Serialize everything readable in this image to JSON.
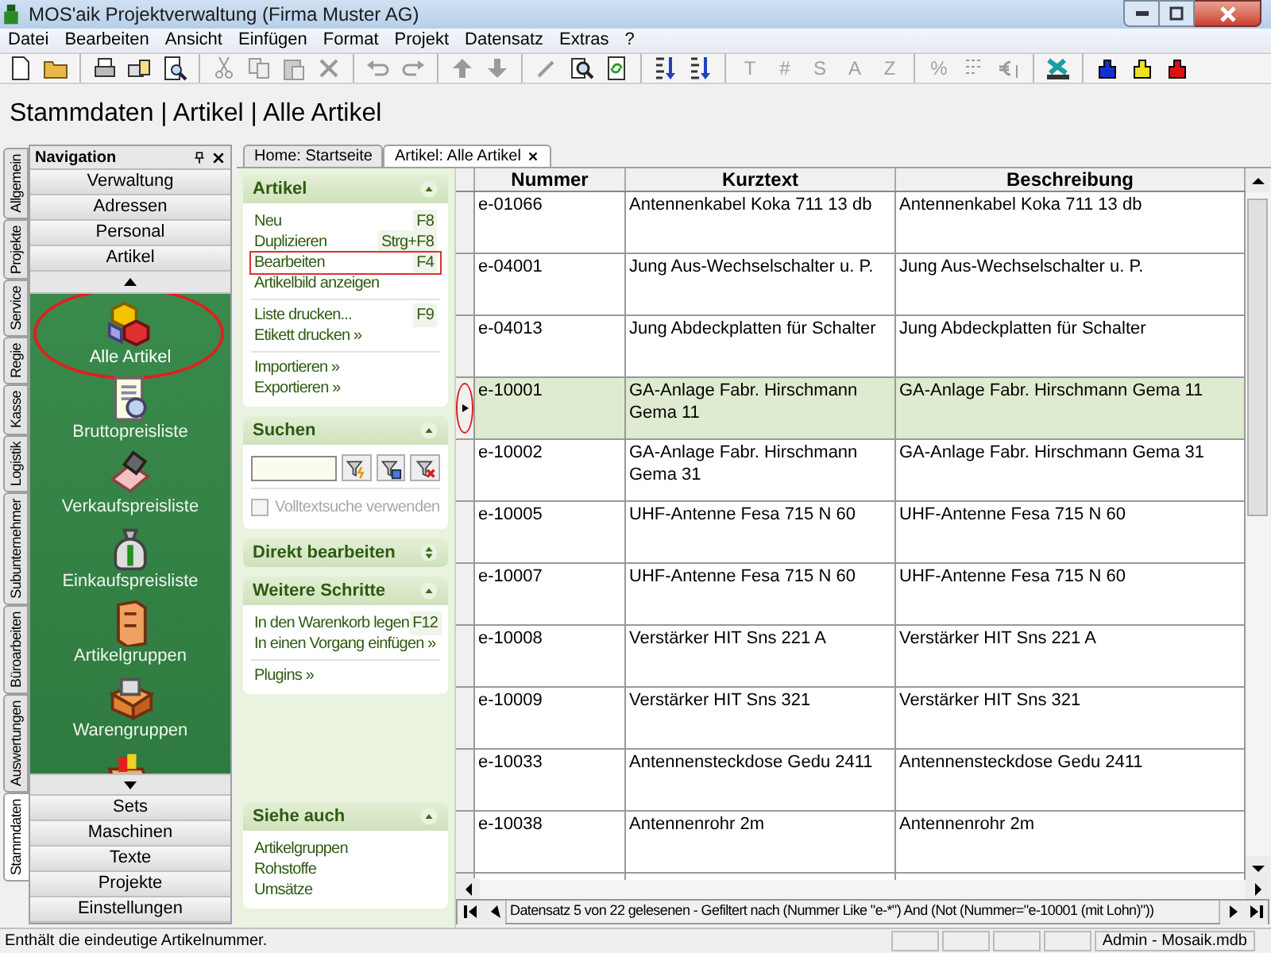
{
  "window": {
    "title": "MOS'aik Projektverwaltung (Firma Muster AG)"
  },
  "menu": [
    "Datei",
    "Bearbeiten",
    "Ansicht",
    "Einfügen",
    "Format",
    "Projekt",
    "Datensatz",
    "Extras",
    "?"
  ],
  "toolbar_glyphs": [
    {
      "text": "T",
      "disabled": true
    },
    {
      "text": "#",
      "disabled": true
    },
    {
      "text": "S",
      "disabled": true
    },
    {
      "text": "A",
      "disabled": true
    },
    {
      "text": "Z",
      "disabled": true
    },
    {
      "text": "%",
      "disabled": true
    }
  ],
  "breadcrumb": "Stammdaten | Artikel | Alle Artikel",
  "side_tabs": [
    {
      "label": "Allgemein",
      "selected": false
    },
    {
      "label": "Projekte",
      "selected": false
    },
    {
      "label": "Service",
      "selected": false
    },
    {
      "label": "Regie",
      "selected": false
    },
    {
      "label": "Kasse",
      "selected": false
    },
    {
      "label": "Logistik",
      "selected": false
    },
    {
      "label": "Subunternehmer",
      "selected": false
    },
    {
      "label": "Büroarbeiten",
      "selected": false
    },
    {
      "label": "Auswertungen",
      "selected": false
    },
    {
      "label": "Stammdaten",
      "selected": true
    }
  ],
  "navigation": {
    "title": "Navigation",
    "top_buttons": [
      "Verwaltung",
      "Adressen",
      "Personal",
      "Artikel"
    ],
    "items": [
      {
        "label": "Alle Artikel",
        "selected": true
      },
      {
        "label": "Bruttopreisliste",
        "selected": false
      },
      {
        "label": "Verkaufspreisliste",
        "selected": false
      },
      {
        "label": "Einkaufspreisliste",
        "selected": false
      },
      {
        "label": "Artikelgruppen",
        "selected": false
      },
      {
        "label": "Warengruppen",
        "selected": false
      }
    ],
    "bottom_buttons": [
      "Sets",
      "Maschinen",
      "Texte",
      "Projekte",
      "Einstellungen"
    ]
  },
  "doc_tabs": [
    {
      "label": "Home: Startseite",
      "selected": false
    },
    {
      "label": "Artikel: Alle Artikel",
      "selected": true
    }
  ],
  "task_panel": {
    "sections": [
      {
        "title": "Artikel",
        "kind": "links",
        "expanded": true,
        "groups": [
          [
            {
              "label": "Neu",
              "shortcut": "F8",
              "highlighted": false
            },
            {
              "label": "Duplizieren",
              "shortcut": "Strg+F8",
              "highlighted": false
            },
            {
              "label": "Bearbeiten",
              "shortcut": "F4",
              "highlighted": true
            },
            {
              "label": "Artikelbild anzeigen",
              "highlighted": false
            }
          ],
          [
            {
              "label": "Liste drucken...",
              "shortcut": "F9",
              "highlighted": false
            },
            {
              "label": "Etikett drucken »",
              "highlighted": false
            }
          ],
          [
            {
              "label": "Importieren »",
              "highlighted": false
            },
            {
              "label": "Exportieren »",
              "highlighted": false
            }
          ]
        ]
      },
      {
        "title": "Suchen",
        "kind": "search",
        "expanded": true,
        "checkbox": {
          "label": "Volltextsuche verwenden",
          "checked": false,
          "disabled": true
        }
      },
      {
        "title": "Direkt bearbeiten",
        "expanded": false
      },
      {
        "title": "Weitere Schritte",
        "kind": "links",
        "expanded": true,
        "groups": [
          [
            {
              "label": "In den Warenkorb legen",
              "shortcut": "F12",
              "highlighted": false
            },
            {
              "label": "In einen Vorgang einfügen »",
              "highlighted": false
            }
          ],
          [
            {
              "label": "Plugins »",
              "highlighted": false
            }
          ]
        ]
      },
      {
        "title": "Siehe auch",
        "kind": "links",
        "expanded": true,
        "groups": [
          [
            {
              "label": "Artikelgruppen",
              "highlighted": false
            },
            {
              "label": "Rohstoffe",
              "highlighted": false
            },
            {
              "label": "Umsätze",
              "highlighted": false
            }
          ]
        ]
      }
    ]
  },
  "grid": {
    "columns": [
      "Nummer",
      "Kurztext",
      "Beschreibung"
    ],
    "rows": [
      {
        "cells": [
          "e-01066",
          "Antennenkabel Koka 711 13 db",
          "Antennenkabel Koka 711 13 db"
        ],
        "selected": false
      },
      {
        "cells": [
          "e-04001",
          "Jung Aus-Wechselschalter u. P.",
          "Jung Aus-Wechselschalter u. P."
        ],
        "selected": false
      },
      {
        "cells": [
          "e-04013",
          "Jung Abdeckplatten für Schalter",
          "Jung Abdeckplatten für Schalter"
        ],
        "selected": false
      },
      {
        "cells": [
          "e-10001",
          "GA-Anlage Fabr. Hirschmann Gema 11",
          "GA-Anlage Fabr. Hirschmann Gema 11"
        ],
        "selected": true
      },
      {
        "cells": [
          "e-10002",
          "GA-Anlage Fabr. Hirschmann Gema 31",
          "GA-Anlage Fabr. Hirschmann Gema 31"
        ],
        "selected": false
      },
      {
        "cells": [
          "e-10005",
          "UHF-Antenne Fesa 715 N 60",
          "UHF-Antenne Fesa 715 N 60"
        ],
        "selected": false
      },
      {
        "cells": [
          "e-10007",
          "UHF-Antenne Fesa 715 N 60",
          "UHF-Antenne Fesa 715 N 60"
        ],
        "selected": false
      },
      {
        "cells": [
          "e-10008",
          "Verstärker HIT Sns 221 A",
          "Verstärker HIT Sns 221 A"
        ],
        "selected": false
      },
      {
        "cells": [
          "e-10009",
          "Verstärker HIT Sns 321",
          "Verstärker HIT Sns 321"
        ],
        "selected": false
      },
      {
        "cells": [
          "e-10033",
          "Antennensteckdose Gedu 2411",
          "Antennensteckdose Gedu 2411"
        ],
        "selected": false
      },
      {
        "cells": [
          "e-10038",
          "Antennenrohr 2m",
          "Antennenrohr 2m"
        ],
        "selected": false
      }
    ],
    "navigator": "Datensatz 5 von 22 gelesenen - Gefiltert nach (Nummer Like \"e-*\") And (Not (Nummer=\"e-10001 (mit Lohn)\"))"
  },
  "status_bar": {
    "message": "Enthält die eindeutige Artikelnummer.",
    "panes": [
      "Admin - Mosaik.mdb"
    ]
  }
}
